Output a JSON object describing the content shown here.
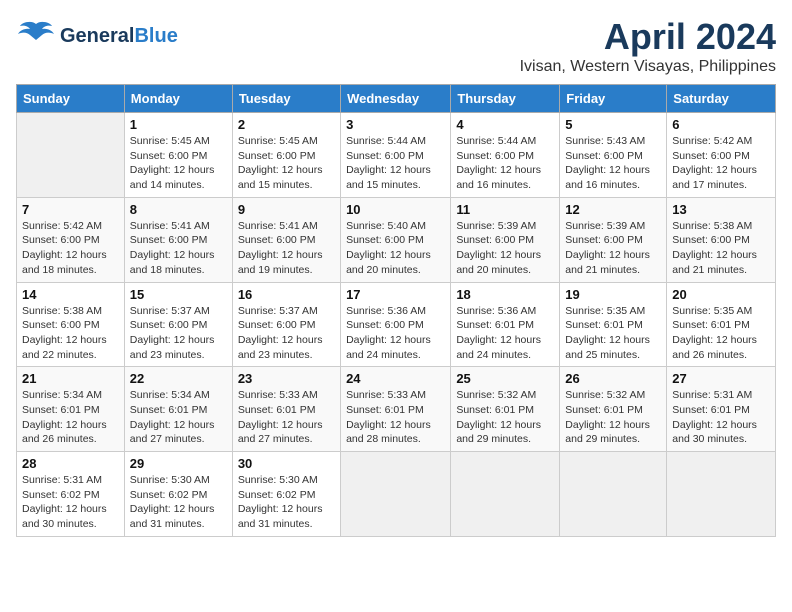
{
  "header": {
    "logo_general": "General",
    "logo_blue": "Blue",
    "month": "April 2024",
    "location": "Ivisan, Western Visayas, Philippines"
  },
  "days_of_week": [
    "Sunday",
    "Monday",
    "Tuesday",
    "Wednesday",
    "Thursday",
    "Friday",
    "Saturday"
  ],
  "weeks": [
    [
      {
        "day": "",
        "info": ""
      },
      {
        "day": "1",
        "info": "Sunrise: 5:45 AM\nSunset: 6:00 PM\nDaylight: 12 hours\nand 14 minutes."
      },
      {
        "day": "2",
        "info": "Sunrise: 5:45 AM\nSunset: 6:00 PM\nDaylight: 12 hours\nand 15 minutes."
      },
      {
        "day": "3",
        "info": "Sunrise: 5:44 AM\nSunset: 6:00 PM\nDaylight: 12 hours\nand 15 minutes."
      },
      {
        "day": "4",
        "info": "Sunrise: 5:44 AM\nSunset: 6:00 PM\nDaylight: 12 hours\nand 16 minutes."
      },
      {
        "day": "5",
        "info": "Sunrise: 5:43 AM\nSunset: 6:00 PM\nDaylight: 12 hours\nand 16 minutes."
      },
      {
        "day": "6",
        "info": "Sunrise: 5:42 AM\nSunset: 6:00 PM\nDaylight: 12 hours\nand 17 minutes."
      }
    ],
    [
      {
        "day": "7",
        "info": "Sunrise: 5:42 AM\nSunset: 6:00 PM\nDaylight: 12 hours\nand 18 minutes."
      },
      {
        "day": "8",
        "info": "Sunrise: 5:41 AM\nSunset: 6:00 PM\nDaylight: 12 hours\nand 18 minutes."
      },
      {
        "day": "9",
        "info": "Sunrise: 5:41 AM\nSunset: 6:00 PM\nDaylight: 12 hours\nand 19 minutes."
      },
      {
        "day": "10",
        "info": "Sunrise: 5:40 AM\nSunset: 6:00 PM\nDaylight: 12 hours\nand 20 minutes."
      },
      {
        "day": "11",
        "info": "Sunrise: 5:39 AM\nSunset: 6:00 PM\nDaylight: 12 hours\nand 20 minutes."
      },
      {
        "day": "12",
        "info": "Sunrise: 5:39 AM\nSunset: 6:00 PM\nDaylight: 12 hours\nand 21 minutes."
      },
      {
        "day": "13",
        "info": "Sunrise: 5:38 AM\nSunset: 6:00 PM\nDaylight: 12 hours\nand 21 minutes."
      }
    ],
    [
      {
        "day": "14",
        "info": "Sunrise: 5:38 AM\nSunset: 6:00 PM\nDaylight: 12 hours\nand 22 minutes."
      },
      {
        "day": "15",
        "info": "Sunrise: 5:37 AM\nSunset: 6:00 PM\nDaylight: 12 hours\nand 23 minutes."
      },
      {
        "day": "16",
        "info": "Sunrise: 5:37 AM\nSunset: 6:00 PM\nDaylight: 12 hours\nand 23 minutes."
      },
      {
        "day": "17",
        "info": "Sunrise: 5:36 AM\nSunset: 6:00 PM\nDaylight: 12 hours\nand 24 minutes."
      },
      {
        "day": "18",
        "info": "Sunrise: 5:36 AM\nSunset: 6:01 PM\nDaylight: 12 hours\nand 24 minutes."
      },
      {
        "day": "19",
        "info": "Sunrise: 5:35 AM\nSunset: 6:01 PM\nDaylight: 12 hours\nand 25 minutes."
      },
      {
        "day": "20",
        "info": "Sunrise: 5:35 AM\nSunset: 6:01 PM\nDaylight: 12 hours\nand 26 minutes."
      }
    ],
    [
      {
        "day": "21",
        "info": "Sunrise: 5:34 AM\nSunset: 6:01 PM\nDaylight: 12 hours\nand 26 minutes."
      },
      {
        "day": "22",
        "info": "Sunrise: 5:34 AM\nSunset: 6:01 PM\nDaylight: 12 hours\nand 27 minutes."
      },
      {
        "day": "23",
        "info": "Sunrise: 5:33 AM\nSunset: 6:01 PM\nDaylight: 12 hours\nand 27 minutes."
      },
      {
        "day": "24",
        "info": "Sunrise: 5:33 AM\nSunset: 6:01 PM\nDaylight: 12 hours\nand 28 minutes."
      },
      {
        "day": "25",
        "info": "Sunrise: 5:32 AM\nSunset: 6:01 PM\nDaylight: 12 hours\nand 29 minutes."
      },
      {
        "day": "26",
        "info": "Sunrise: 5:32 AM\nSunset: 6:01 PM\nDaylight: 12 hours\nand 29 minutes."
      },
      {
        "day": "27",
        "info": "Sunrise: 5:31 AM\nSunset: 6:01 PM\nDaylight: 12 hours\nand 30 minutes."
      }
    ],
    [
      {
        "day": "28",
        "info": "Sunrise: 5:31 AM\nSunset: 6:02 PM\nDaylight: 12 hours\nand 30 minutes."
      },
      {
        "day": "29",
        "info": "Sunrise: 5:30 AM\nSunset: 6:02 PM\nDaylight: 12 hours\nand 31 minutes."
      },
      {
        "day": "30",
        "info": "Sunrise: 5:30 AM\nSunset: 6:02 PM\nDaylight: 12 hours\nand 31 minutes."
      },
      {
        "day": "",
        "info": ""
      },
      {
        "day": "",
        "info": ""
      },
      {
        "day": "",
        "info": ""
      },
      {
        "day": "",
        "info": ""
      }
    ]
  ]
}
